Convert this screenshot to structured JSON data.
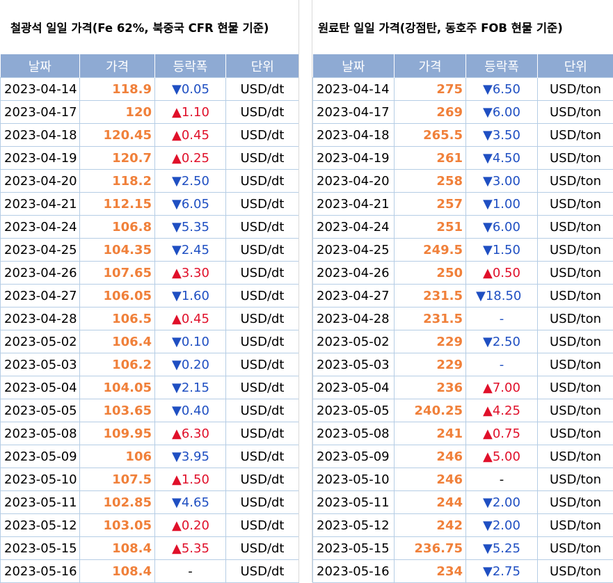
{
  "colors": {
    "header_bg": "#8eaad3",
    "price": "#f0803a",
    "down": "#1f4fc2",
    "up": "#e0102a",
    "grid": "#b5cde5"
  },
  "left": {
    "title": "철광석 일일 가격(Fe 62%, 북중국 CFR 현물 기준)",
    "headers": [
      "날짜",
      "가격",
      "등락폭",
      "단위"
    ],
    "rows": [
      {
        "date": "2023-04-14",
        "price": "118.9",
        "change": "▼0.05",
        "dir": "down",
        "unit": "USD/dt"
      },
      {
        "date": "2023-04-17",
        "price": "120",
        "change": "▲1.10",
        "dir": "up",
        "unit": "USD/dt"
      },
      {
        "date": "2023-04-18",
        "price": "120.45",
        "change": "▲0.45",
        "dir": "up",
        "unit": "USD/dt"
      },
      {
        "date": "2023-04-19",
        "price": "120.7",
        "change": "▲0.25",
        "dir": "up",
        "unit": "USD/dt"
      },
      {
        "date": "2023-04-20",
        "price": "118.2",
        "change": "▼2.50",
        "dir": "down",
        "unit": "USD/dt"
      },
      {
        "date": "2023-04-21",
        "price": "112.15",
        "change": "▼6.05",
        "dir": "down",
        "unit": "USD/dt"
      },
      {
        "date": "2023-04-24",
        "price": "106.8",
        "change": "▼5.35",
        "dir": "down",
        "unit": "USD/dt"
      },
      {
        "date": "2023-04-25",
        "price": "104.35",
        "change": "▼2.45",
        "dir": "down",
        "unit": "USD/dt"
      },
      {
        "date": "2023-04-26",
        "price": "107.65",
        "change": "▲3.30",
        "dir": "up",
        "unit": "USD/dt"
      },
      {
        "date": "2023-04-27",
        "price": "106.05",
        "change": "▼1.60",
        "dir": "down",
        "unit": "USD/dt"
      },
      {
        "date": "2023-04-28",
        "price": "106.5",
        "change": "▲0.45",
        "dir": "up",
        "unit": "USD/dt"
      },
      {
        "date": "2023-05-02",
        "price": "106.4",
        "change": "▼0.10",
        "dir": "down",
        "unit": "USD/dt"
      },
      {
        "date": "2023-05-03",
        "price": "106.2",
        "change": "▼0.20",
        "dir": "down",
        "unit": "USD/dt"
      },
      {
        "date": "2023-05-04",
        "price": "104.05",
        "change": "▼2.15",
        "dir": "down",
        "unit": "USD/dt"
      },
      {
        "date": "2023-05-05",
        "price": "103.65",
        "change": "▼0.40",
        "dir": "down",
        "unit": "USD/dt"
      },
      {
        "date": "2023-05-08",
        "price": "109.95",
        "change": "▲6.30",
        "dir": "up",
        "unit": "USD/dt"
      },
      {
        "date": "2023-05-09",
        "price": "106",
        "change": "▼3.95",
        "dir": "down",
        "unit": "USD/dt"
      },
      {
        "date": "2023-05-10",
        "price": "107.5",
        "change": "▲1.50",
        "dir": "up",
        "unit": "USD/dt"
      },
      {
        "date": "2023-05-11",
        "price": "102.85",
        "change": "▼4.65",
        "dir": "down",
        "unit": "USD/dt"
      },
      {
        "date": "2023-05-12",
        "price": "103.05",
        "change": "▲0.20",
        "dir": "up",
        "unit": "USD/dt"
      },
      {
        "date": "2023-05-15",
        "price": "108.4",
        "change": "▲5.35",
        "dir": "up",
        "unit": "USD/dt"
      },
      {
        "date": "2023-05-16",
        "price": "108.4",
        "change": "-",
        "dir": "flat-black",
        "unit": "USD/dt"
      }
    ]
  },
  "right": {
    "title": "원료탄 일일 가격(강점탄, 동호주 FOB 현물 기준)",
    "headers": [
      "날짜",
      "가격",
      "등락폭",
      "단위"
    ],
    "rows": [
      {
        "date": "2023-04-14",
        "price": "275",
        "change": "▼6.50",
        "dir": "down",
        "unit": "USD/ton"
      },
      {
        "date": "2023-04-17",
        "price": "269",
        "change": "▼6.00",
        "dir": "down",
        "unit": "USD/ton"
      },
      {
        "date": "2023-04-18",
        "price": "265.5",
        "change": "▼3.50",
        "dir": "down",
        "unit": "USD/ton"
      },
      {
        "date": "2023-04-19",
        "price": "261",
        "change": "▼4.50",
        "dir": "down",
        "unit": "USD/ton"
      },
      {
        "date": "2023-04-20",
        "price": "258",
        "change": "▼3.00",
        "dir": "down",
        "unit": "USD/ton"
      },
      {
        "date": "2023-04-21",
        "price": "257",
        "change": "▼1.00",
        "dir": "down",
        "unit": "USD/ton"
      },
      {
        "date": "2023-04-24",
        "price": "251",
        "change": "▼6.00",
        "dir": "down",
        "unit": "USD/ton"
      },
      {
        "date": "2023-04-25",
        "price": "249.5",
        "change": "▼1.50",
        "dir": "down",
        "unit": "USD/ton"
      },
      {
        "date": "2023-04-26",
        "price": "250",
        "change": "▲0.50",
        "dir": "up",
        "unit": "USD/ton"
      },
      {
        "date": "2023-04-27",
        "price": "231.5",
        "change": "▼18.50",
        "dir": "down-wide",
        "unit": "USD/ton"
      },
      {
        "date": "2023-04-28",
        "price": "231.5",
        "change": "-",
        "dir": "flat-blue",
        "unit": "USD/ton"
      },
      {
        "date": "2023-05-02",
        "price": "229",
        "change": "▼2.50",
        "dir": "down",
        "unit": "USD/ton"
      },
      {
        "date": "2023-05-03",
        "price": "229",
        "change": "-",
        "dir": "flat-blue",
        "unit": "USD/ton"
      },
      {
        "date": "2023-05-04",
        "price": "236",
        "change": "▲7.00",
        "dir": "up",
        "unit": "USD/ton"
      },
      {
        "date": "2023-05-05",
        "price": "240.25",
        "change": "▲4.25",
        "dir": "up",
        "unit": "USD/ton"
      },
      {
        "date": "2023-05-08",
        "price": "241",
        "change": "▲0.75",
        "dir": "up",
        "unit": "USD/ton"
      },
      {
        "date": "2023-05-09",
        "price": "246",
        "change": "▲5.00",
        "dir": "up",
        "unit": "USD/ton"
      },
      {
        "date": "2023-05-10",
        "price": "246",
        "change": "-",
        "dir": "flat-black",
        "unit": "USD/ton"
      },
      {
        "date": "2023-05-11",
        "price": "244",
        "change": "▼2.00",
        "dir": "down",
        "unit": "USD/ton"
      },
      {
        "date": "2023-05-12",
        "price": "242",
        "change": "▼2.00",
        "dir": "down",
        "unit": "USD/ton"
      },
      {
        "date": "2023-05-15",
        "price": "236.75",
        "change": "▼5.25",
        "dir": "down",
        "unit": "USD/ton"
      },
      {
        "date": "2023-05-16",
        "price": "234",
        "change": "▼2.75",
        "dir": "down",
        "unit": "USD/ton"
      }
    ]
  }
}
